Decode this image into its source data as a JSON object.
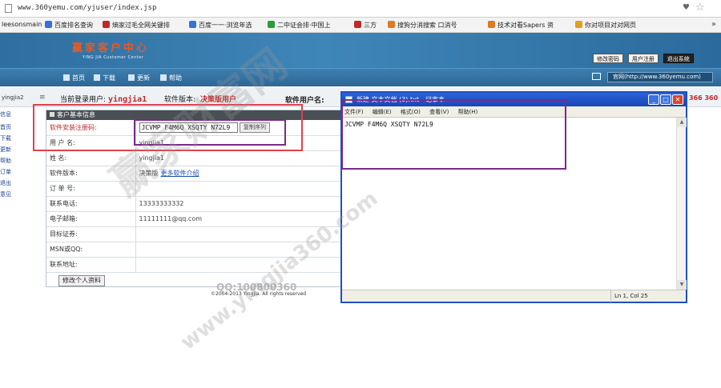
{
  "browser": {
    "url": "www.360yemu.com/yjuser/index.jsp",
    "bookmarks": [
      {
        "label": "leesonsmain",
        "color": "#888888"
      },
      {
        "label": "百度排名查询",
        "color": "#3a6fd8"
      },
      {
        "label": "熵家过毛全网关键排",
        "color": "#c0282a"
      },
      {
        "label": "百度一一·浏览年选",
        "color": "#3a6fd8"
      },
      {
        "label": "二中证会排·中国上",
        "color": "#2e9a3a"
      },
      {
        "label": "三方",
        "color": "#c0282a"
      },
      {
        "label": "搜狗分消搜索 口消号",
        "color": "#e07a20"
      },
      {
        "label": "技术对看Sapers 资",
        "color": "#e07a20"
      },
      {
        "label": "你对项目对对网页",
        "color": "#e0a020"
      }
    ]
  },
  "site": {
    "logo": "赢家客户中心",
    "logo_sub": "YING JIA Customer Center",
    "header_buttons": [
      "修改密码",
      "用户注册",
      "退出系统"
    ],
    "nav": [
      "首页",
      "下载",
      "更新",
      "帮助"
    ],
    "nav_right": "官网(http://www.360yemu.com)"
  },
  "status": {
    "left_id": "yingjia2",
    "current_label": "当前登录用户:",
    "current_user": "yingjia1",
    "version_label": "软件版本:",
    "version": "决策版用户",
    "software_user_label": "软件用户名:",
    "edge_number": "366 360"
  },
  "sidebar": [
    "信息",
    "首页",
    "下载",
    "更新",
    "帮助",
    "订单",
    "退出",
    "意见"
  ],
  "panel": {
    "title": "客户基本信息",
    "rows": [
      {
        "label": "软件安装注册码:",
        "value": "JCVMP F4M6Q XSQTY N72L9",
        "copy": "复制序列"
      },
      {
        "label": "用 户 名:",
        "value": "yingjia1"
      },
      {
        "label": "姓    名:",
        "value": "yingjia1"
      },
      {
        "label": "软件版本:",
        "value": "决策版",
        "link": "更多软件介绍"
      },
      {
        "label": "订 单 号:",
        "value": ""
      },
      {
        "label": "联系电话:",
        "value": "13333333332"
      },
      {
        "label": "电子邮箱:",
        "value": "11111111@qq.com"
      },
      {
        "label": "目标证券:",
        "value": ""
      },
      {
        "label": "MSN或QQ:",
        "value": ""
      },
      {
        "label": "联系地址:",
        "value": ""
      }
    ],
    "edit_button": "修改个人资料"
  },
  "footer": {
    "copyright": "©2004-2013 YingJia. All rights reserved",
    "qq": "QQ:100800360"
  },
  "notepad": {
    "title": "新建 文本文档 (3).txt - 记事本",
    "menu": [
      "文件(F)",
      "编辑(E)",
      "格式(O)",
      "查看(V)",
      "帮助(H)"
    ],
    "content": "JCVMP F4M6Q XSQTY N72L9",
    "status_pos": "Ln 1, Col 25"
  },
  "watermark": {
    "main": "赢家财富网",
    "url": "www.yingjia360.com"
  },
  "colors": {
    "header_blue": "#3f86b8",
    "highlight_red": "#e04050",
    "highlight_purple": "#7a2a8a",
    "notepad_blue": "#1f4fc4"
  }
}
